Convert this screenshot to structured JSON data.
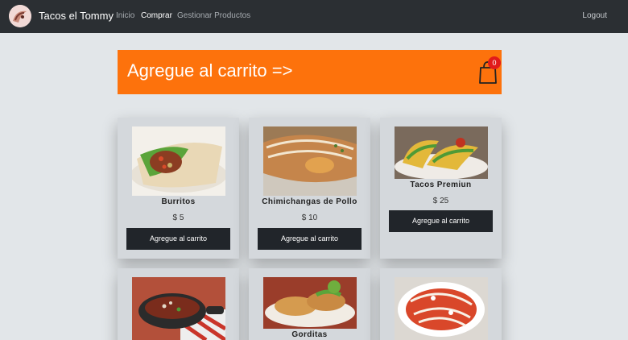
{
  "nav": {
    "brand": "Tacos el Tommy",
    "links": [
      {
        "label": "Inicio"
      },
      {
        "label": "Comprar"
      },
      {
        "label": "Gestionar Productos"
      }
    ],
    "logout": "Logout"
  },
  "banner": {
    "title": "Agregue al carrito =>",
    "cart_count": "0",
    "color": "#fd720c"
  },
  "products": [
    {
      "name": "Burritos",
      "price": "$ 5",
      "button": "Agregue al carrito"
    },
    {
      "name": "Chimichangas de Pollo",
      "price": "$ 10",
      "button": "Agregue al carrito"
    },
    {
      "name": "Tacos Premiun",
      "price": "$ 25",
      "button": "Agregue al carrito"
    },
    {
      "name": ""
    },
    {
      "name": "Gorditas"
    },
    {
      "name": ""
    }
  ],
  "colors": {
    "navbar": "#2b2f33",
    "button": "#21252a",
    "badge": "#e11a1a"
  }
}
